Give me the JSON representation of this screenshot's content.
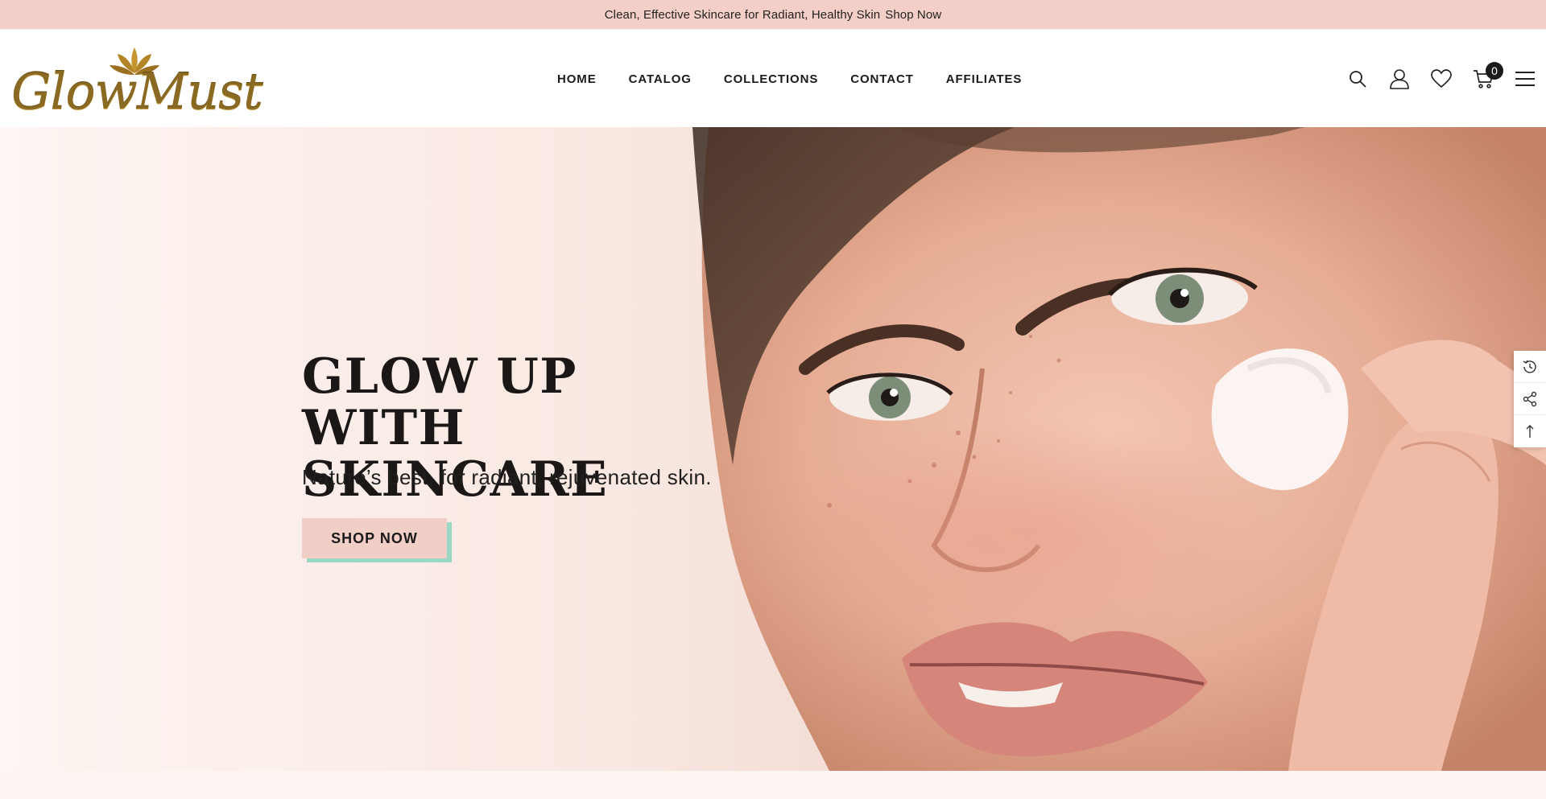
{
  "announcement": {
    "text": "Clean, Effective Skincare for Radiant, Healthy Skin",
    "link": "Shop Now"
  },
  "brand": {
    "name": "GlowMust",
    "color": "#8a6a22"
  },
  "nav": {
    "items": [
      {
        "label": "HOME"
      },
      {
        "label": "CATALOG"
      },
      {
        "label": "COLLECTIONS"
      },
      {
        "label": "CONTACT"
      },
      {
        "label": "AFFILIATES"
      }
    ]
  },
  "header_icons": {
    "search": "search-icon",
    "account": "user-icon",
    "wishlist": "heart-icon",
    "cart": "cart-icon",
    "cart_count": "0",
    "menu": "hamburger-icon"
  },
  "hero": {
    "title": "GLOW UP WITH SKINCARE",
    "subtitle": "Nature’s best, for radiant, rejuvenated skin.",
    "cta": "SHOP NOW",
    "cta_bg": "#f2cfc6",
    "cta_shadow": "#9ad8c6"
  },
  "side_tools": [
    "recently-viewed-icon",
    "share-icon",
    "back-to-top-icon"
  ],
  "colors": {
    "announcement_bg": "#f4cfc7",
    "hero_bg": "#f9e8e2"
  }
}
